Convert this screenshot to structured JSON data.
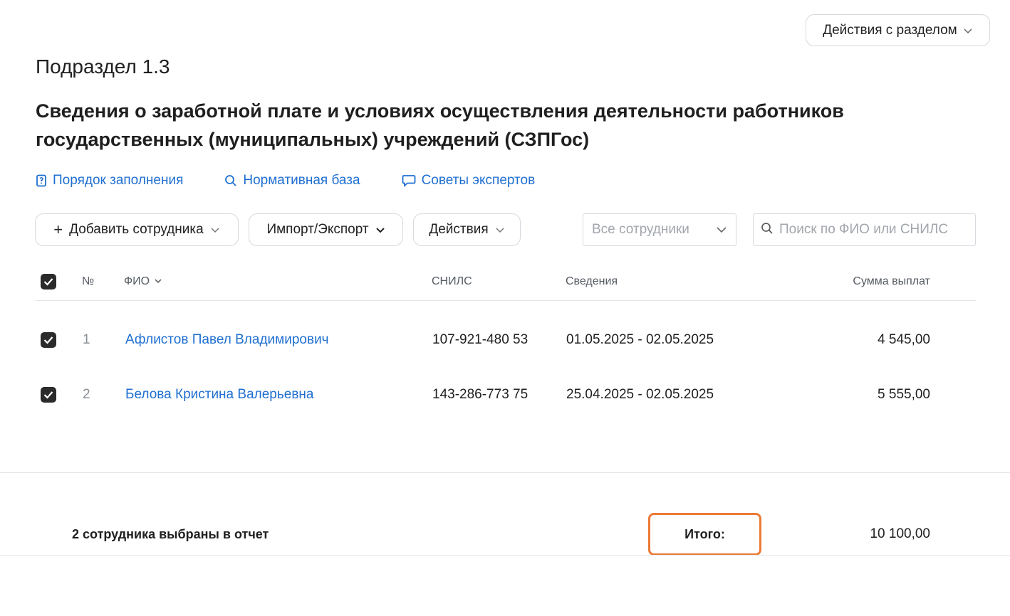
{
  "header": {
    "section_actions_label": "Действия с разделом",
    "subsection": "Подраздел 1.3",
    "title": "Сведения о заработной плате и условиях осуществления деятельности работников государственных (муниципальных) учреждений (СЗПГос)"
  },
  "links": [
    {
      "label": "Порядок заполнения",
      "icon": "book-icon"
    },
    {
      "label": "Нормативная база",
      "icon": "search-icon"
    },
    {
      "label": "Советы экспертов",
      "icon": "chat-icon"
    }
  ],
  "toolbar": {
    "add_employee_label": "Добавить сотрудника",
    "add_employee_prefix": "+",
    "import_export_label": "Импорт/Экспорт",
    "actions_label": "Действия",
    "filter_value": "Все сотрудники",
    "search_placeholder": "Поиск по ФИО или СНИЛС"
  },
  "table": {
    "columns": {
      "num": "№",
      "fio": "ФИО",
      "snils": "СНИЛС",
      "info": "Сведения",
      "sum": "Сумма выплат"
    },
    "rows": [
      {
        "num": "1",
        "name": "Афлистов Павел Владимирович",
        "snils": "107-921-480 53",
        "period": "01.05.2025 - 02.05.2025",
        "sum": "4 545,00",
        "checked": true
      },
      {
        "num": "2",
        "name": "Белова Кристина Валерьевна",
        "snils": "143-286-773 75",
        "period": "25.04.2025 - 02.05.2025",
        "sum": "5 555,00",
        "checked": true
      }
    ],
    "select_all_checked": true
  },
  "footer": {
    "selected_text": "2 сотрудника выбраны в отчет",
    "total_label": "Итого:",
    "total_value": "10 100,00"
  },
  "colors": {
    "link": "#1f6fd1",
    "highlight_border": "#ed7a36",
    "checkbox": "#2b2b2b"
  }
}
